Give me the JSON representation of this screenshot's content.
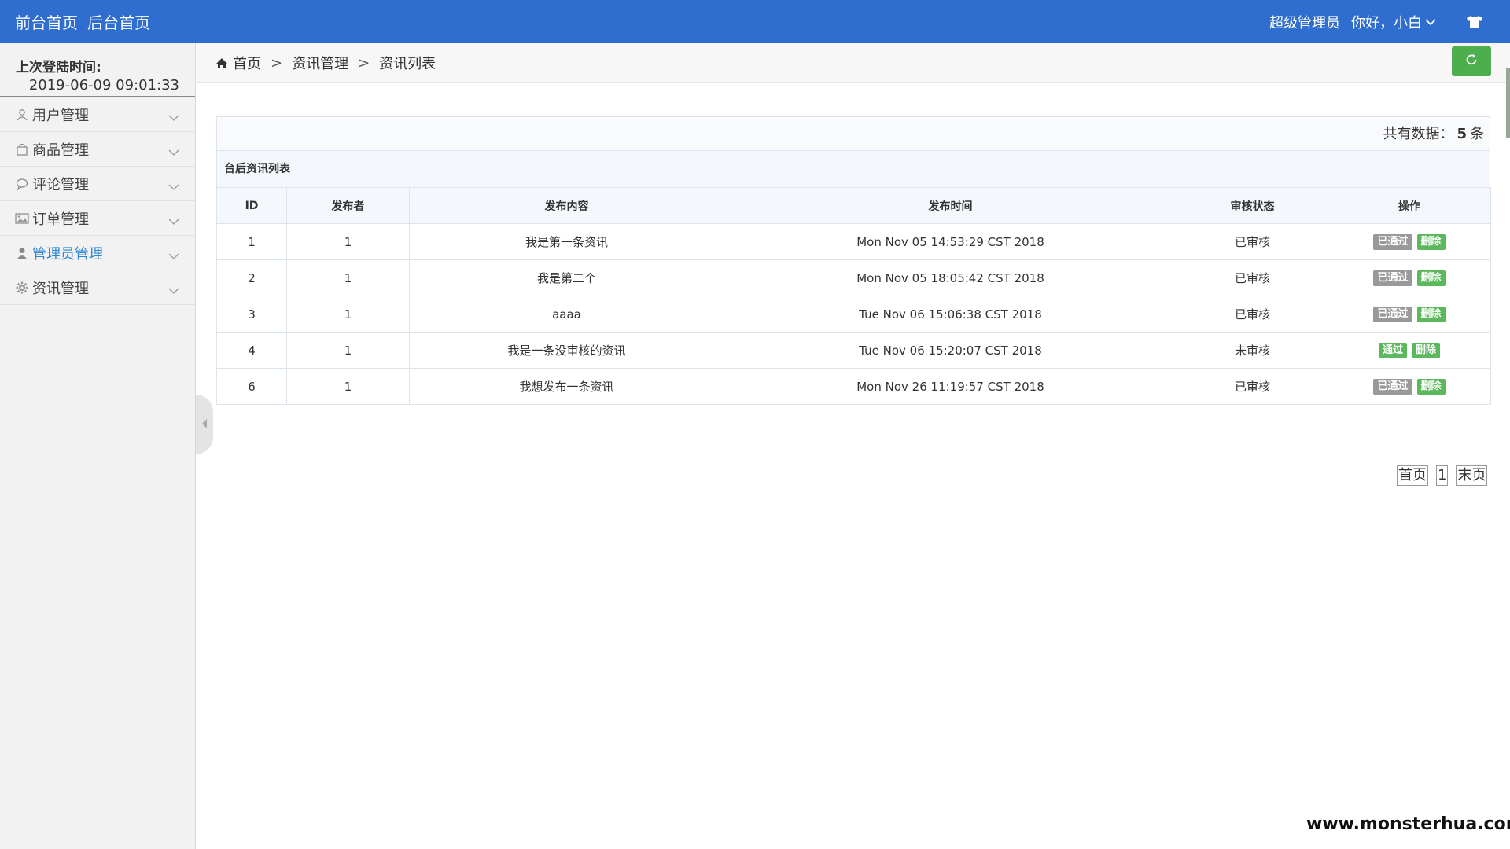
{
  "navbar": {
    "links": [
      "前台首页",
      "后台首页"
    ],
    "role": "超级管理员",
    "greeting": "你好，小白",
    "icons": [
      "chevron-down-icon",
      "shirt-icon"
    ]
  },
  "sidebar": {
    "login_label": "上次登陆时间:",
    "login_time": "2019-06-09 09:01:33",
    "items": [
      {
        "label": "用户管理",
        "icon": "user-icon"
      },
      {
        "label": "商品管理",
        "icon": "bag-icon"
      },
      {
        "label": "评论管理",
        "icon": "comment-icon"
      },
      {
        "label": "订单管理",
        "icon": "picture-icon"
      },
      {
        "label": "管理员管理",
        "icon": "person-icon",
        "active": true
      },
      {
        "label": "资讯管理",
        "icon": "gear-icon"
      }
    ]
  },
  "breadcrumb": {
    "items": [
      "首页",
      "资讯管理",
      "资讯列表"
    ],
    "separator": ">"
  },
  "panel": {
    "total_prefix": "共有数据：",
    "total_count": "5",
    "total_suffix": "条",
    "title": "台后资讯列表",
    "columns": [
      "ID",
      "发布者",
      "发布内容",
      "发布时间",
      "审核状态",
      "操作"
    ],
    "rows": [
      {
        "id": "1",
        "publisher": "1",
        "content": "我是第一条资讯",
        "time": "Mon Nov 05 14:53:29 CST 2018",
        "status": "已审核",
        "action": "已通过",
        "action_style": "gray",
        "delete": "删除"
      },
      {
        "id": "2",
        "publisher": "1",
        "content": "我是第二个",
        "time": "Mon Nov 05 18:05:42 CST 2018",
        "status": "已审核",
        "action": "已通过",
        "action_style": "gray",
        "delete": "删除"
      },
      {
        "id": "3",
        "publisher": "1",
        "content": "aaaa",
        "time": "Tue Nov 06 15:06:38 CST 2018",
        "status": "已审核",
        "action": "已通过",
        "action_style": "gray",
        "delete": "删除"
      },
      {
        "id": "4",
        "publisher": "1",
        "content": "我是一条没审核的资讯",
        "time": "Tue Nov 06 15:20:07 CST 2018",
        "status": "未审核",
        "action": "通过",
        "action_style": "green",
        "delete": "删除"
      },
      {
        "id": "6",
        "publisher": "1",
        "content": "我想发布一条资讯",
        "time": "Mon Nov 26 11:19:57 CST 2018",
        "status": "已审核",
        "action": "已通过",
        "action_style": "gray",
        "delete": "删除"
      }
    ]
  },
  "pager": {
    "first": "首页",
    "page": "1",
    "last": "末页"
  },
  "watermark": "www.monsterhua.com",
  "colors": {
    "navbar": "#2f6dce",
    "active_menu": "#2f86d6",
    "green": "#5cb85c",
    "gray": "#999999"
  }
}
